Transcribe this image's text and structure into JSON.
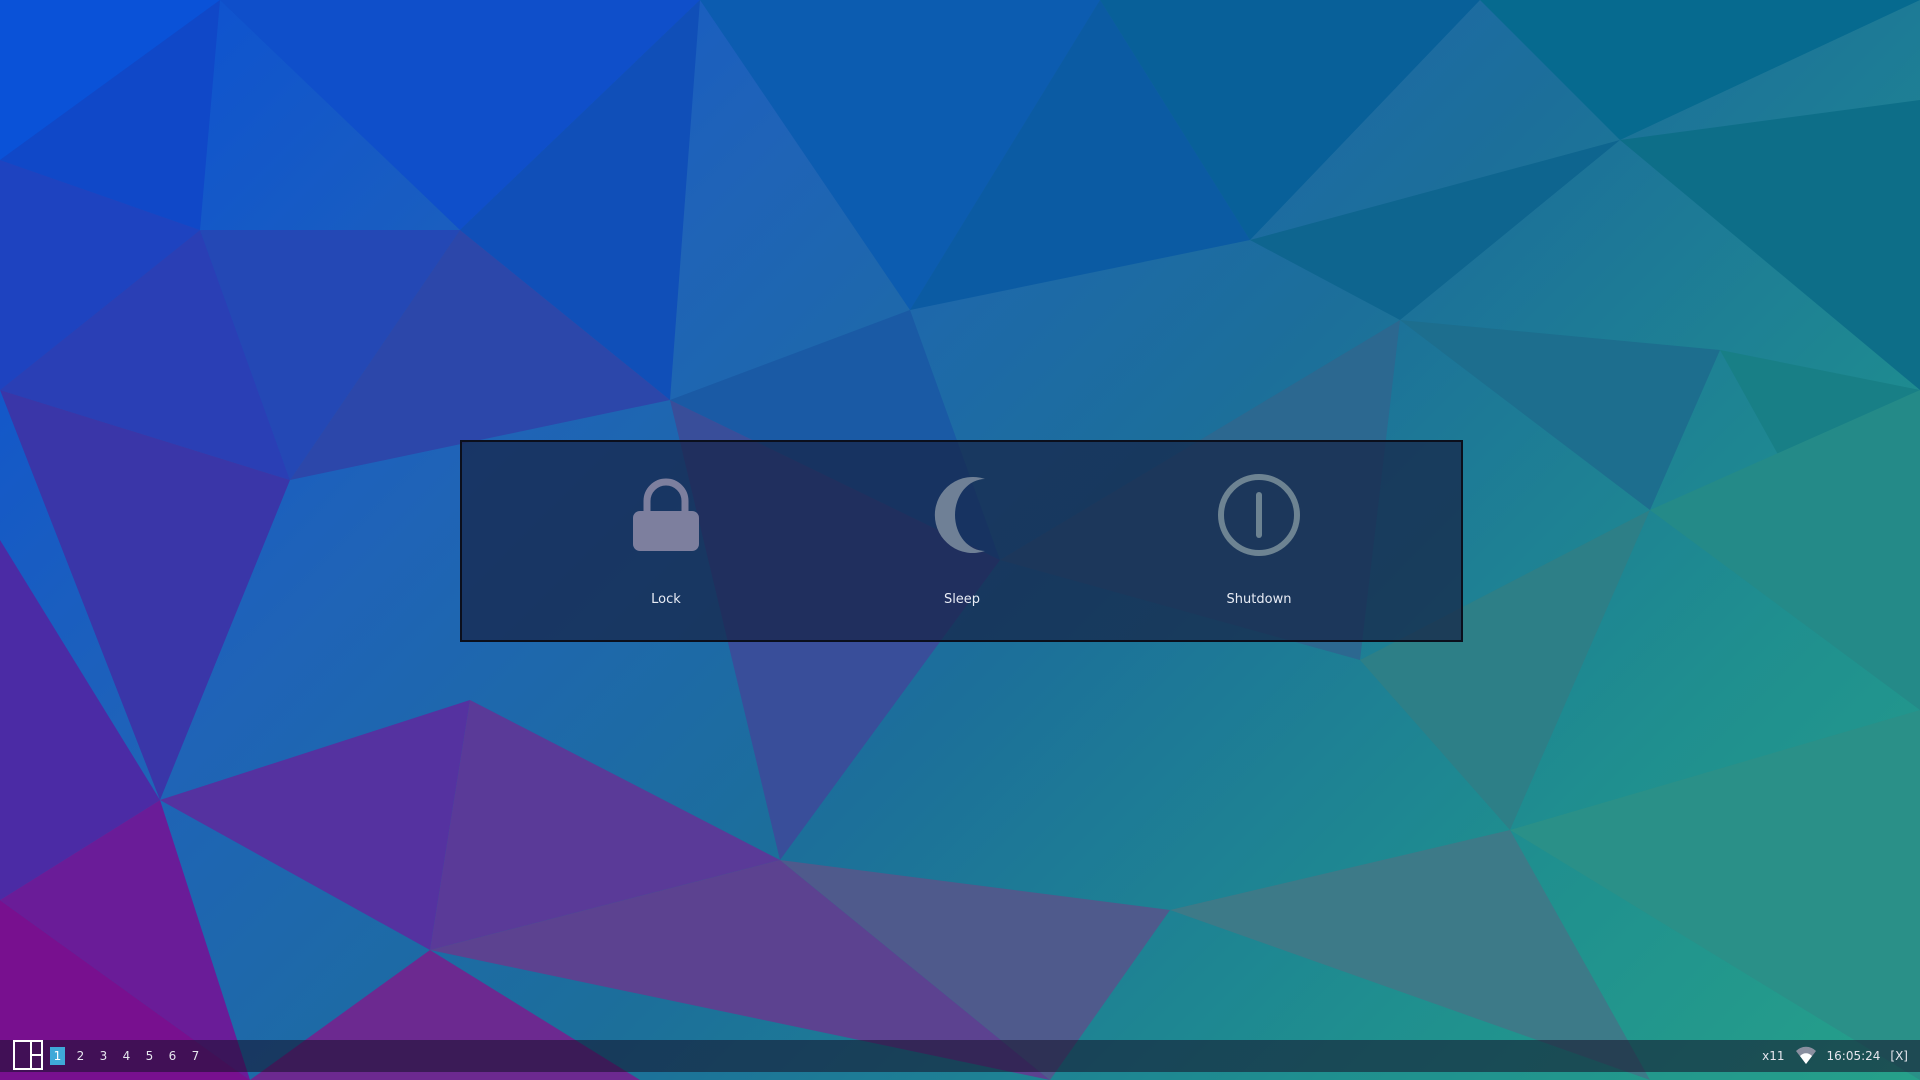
{
  "power_menu": {
    "options": [
      {
        "label": "Lock",
        "icon": "lock-icon"
      },
      {
        "label": "Sleep",
        "icon": "moon-icon"
      },
      {
        "label": "Shutdown",
        "icon": "power-icon"
      }
    ]
  },
  "taskbar": {
    "layout_icon": "layout-icon",
    "workspaces": [
      "1",
      "2",
      "3",
      "4",
      "5",
      "6",
      "7"
    ],
    "active_workspace": "1",
    "keyboard_layout": "x11",
    "network_icon": "wifi-icon",
    "clock": "16:05:24",
    "close_label": "[X]"
  },
  "colors": {
    "accent": "#3fa9d8",
    "icon": "#7d8ca8",
    "dialog_bg": "#16244a"
  }
}
